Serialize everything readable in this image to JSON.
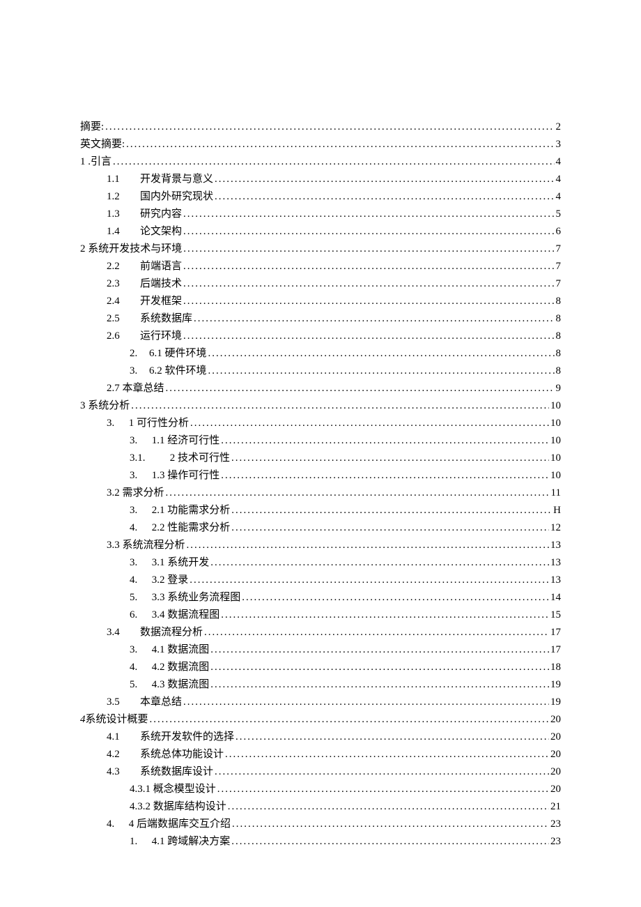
{
  "toc": [
    {
      "indent": 0,
      "num": "",
      "label": "摘要:",
      "page": "2"
    },
    {
      "indent": 0,
      "num": "",
      "label": "英文摘要:",
      "page": "3"
    },
    {
      "indent": 0,
      "num": "1",
      "label": " .引言",
      "page": "4"
    },
    {
      "indent": 1,
      "num": "1.1",
      "label": "开发背景与意义",
      "page": "4"
    },
    {
      "indent": 1,
      "num": "1.2",
      "label": "国内外研究现状",
      "page": "4"
    },
    {
      "indent": 1,
      "num": "1.3",
      "label": "研究内容",
      "page": "5"
    },
    {
      "indent": 1,
      "num": "1.4",
      "label": "论文架构",
      "page": "6"
    },
    {
      "indent": 0,
      "num": "",
      "label": "2 系统开发技术与环境",
      "page": "7"
    },
    {
      "indent": 1,
      "num": "2.2",
      "label": "前端语言",
      "page": "7"
    },
    {
      "indent": 1,
      "num": "2.3",
      "label": "后端技术",
      "page": "7"
    },
    {
      "indent": 1,
      "num": "2.4",
      "label": "开发框架",
      "page": "8"
    },
    {
      "indent": 1,
      "num": "2.5",
      "label": "系统数据库",
      "page": "8"
    },
    {
      "indent": 1,
      "num": "2.6",
      "label": "运行环境",
      "page": "8"
    },
    {
      "indent": 2,
      "num": "2.",
      "label": "6.1 硬件环境",
      "page": "8"
    },
    {
      "indent": 2,
      "num": "3.",
      "label": "6.2 软件环境",
      "page": "8"
    },
    {
      "indent": 1,
      "num": "2.7 ",
      "label": "本章总结",
      "page": "9",
      "nogap": true
    },
    {
      "indent": 0,
      "num": "",
      "label": "3 系统分析",
      "page": "10"
    },
    {
      "indent": 1,
      "num": "3.",
      "label": " 1 可行性分析",
      "page": "10",
      "short": true
    },
    {
      "indent": 2,
      "num": "3.",
      "label": " 1.1 经济可行性",
      "page": "10"
    },
    {
      "indent": 2,
      "num": "3.1.",
      "label": " 2 技术可行性",
      "page": "10",
      "wide": true
    },
    {
      "indent": 2,
      "num": "3.",
      "label": " 1.3 操作可行性",
      "page": "10"
    },
    {
      "indent": 1,
      "num": "3.2 ",
      "label": "需求分析",
      "page": "11",
      "nogap": true
    },
    {
      "indent": 2,
      "num": "3.",
      "label": " 2.1 功能需求分析",
      "page": "H"
    },
    {
      "indent": 2,
      "num": "4.",
      "label": " 2.2 性能需求分析",
      "page": "12"
    },
    {
      "indent": 1,
      "num": "3.3 ",
      "label": "系统流程分析",
      "page": "13",
      "nogap": true
    },
    {
      "indent": 2,
      "num": "3.",
      "label": " 3.1 系统开发",
      "page": "13"
    },
    {
      "indent": 2,
      "num": "4.",
      "label": " 3.2  登录",
      "page": "13"
    },
    {
      "indent": 2,
      "num": "5.",
      "label": " 3.3 系统业务流程图",
      "page": "14"
    },
    {
      "indent": 2,
      "num": "6.",
      "label": " 3.4 数据流程图",
      "page": "15"
    },
    {
      "indent": 1,
      "num": "3.4",
      "label": "数据流程分析",
      "page": "17"
    },
    {
      "indent": 2,
      "num": "3.",
      "label": " 4.1 数据流图",
      "page": "17"
    },
    {
      "indent": 2,
      "num": "4.",
      "label": " 4.2 数据流图",
      "page": "18"
    },
    {
      "indent": 2,
      "num": "5.",
      "label": " 4.3 数据流图",
      "page": "19"
    },
    {
      "indent": 1,
      "num": "3.5",
      "label": "本章总结",
      "page": "19"
    },
    {
      "indent": 0,
      "num": "4",
      "label": "系统设计概要",
      "page": "20",
      "italnum": true
    },
    {
      "indent": 1,
      "num": "4.1",
      "label": "系统开发软件的选择",
      "page": "20"
    },
    {
      "indent": 1,
      "num": "4.2",
      "label": "系统总体功能设计",
      "page": "20"
    },
    {
      "indent": 1,
      "num": "4.3",
      "label": "系统数据库设计",
      "page": "20"
    },
    {
      "indent": 2,
      "num": "",
      "label": "4.3.1 概念模型设计",
      "page": "20",
      "plain": true
    },
    {
      "indent": 2,
      "num": "",
      "label": "4.3.2 数据库结构设计",
      "page": "21",
      "plain": true
    },
    {
      "indent": 1,
      "num": "4.",
      "label": " 4 后端数据库交互介绍",
      "page": "23",
      "short": true
    },
    {
      "indent": 2,
      "num": "1.",
      "label": " 4.1 跨域解决方案",
      "page": "23"
    }
  ]
}
